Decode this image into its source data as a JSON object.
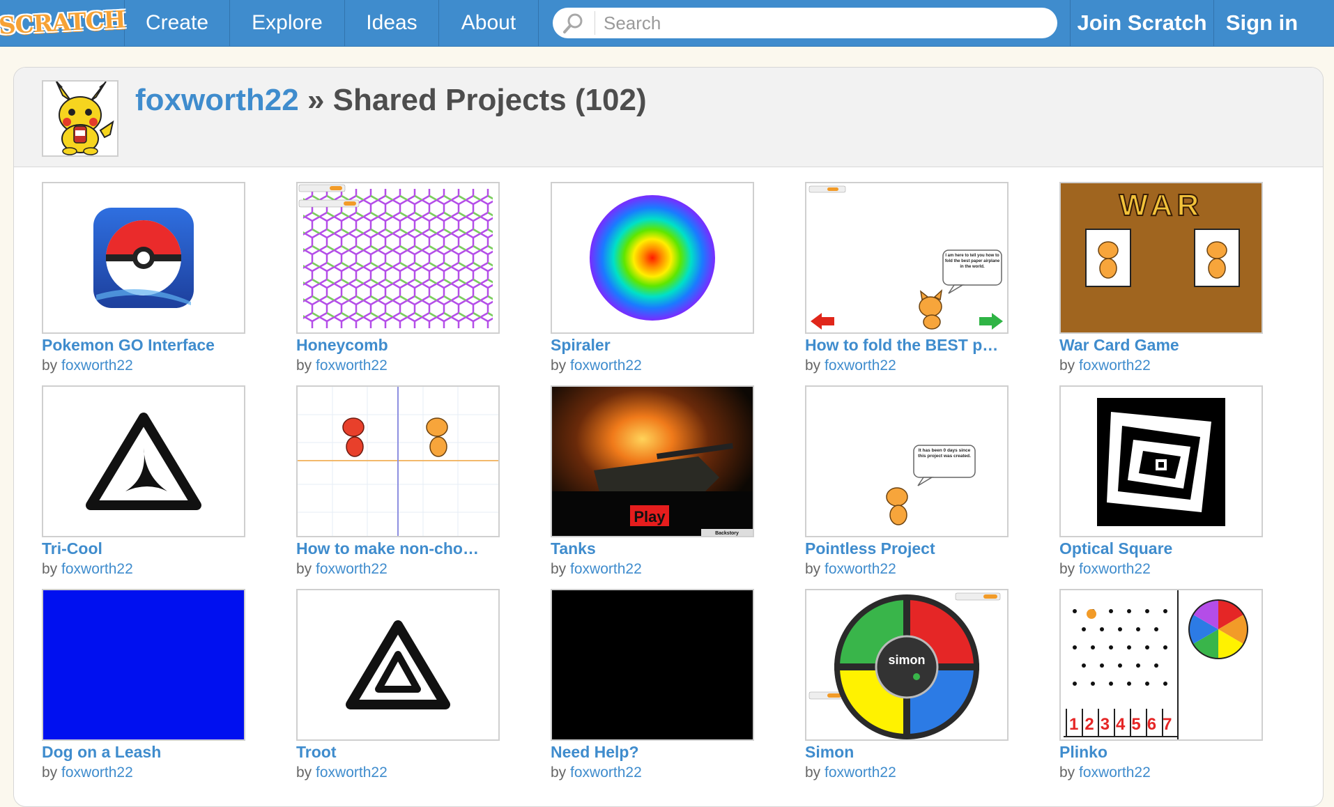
{
  "header": {
    "logo_text": "SCRATCH",
    "nav": [
      {
        "label": "Create"
      },
      {
        "label": "Explore"
      },
      {
        "label": "Ideas"
      },
      {
        "label": "About"
      }
    ],
    "search_placeholder": "Search",
    "join_label": "Join Scratch",
    "signin_label": "Sign in"
  },
  "page": {
    "username": "foxworth22",
    "separator": "»",
    "section_title": "Shared Projects (102)"
  },
  "by_label": "by",
  "projects": [
    {
      "title": "Pokemon GO Interface",
      "owner": "foxworth22"
    },
    {
      "title": "Honeycomb",
      "owner": "foxworth22"
    },
    {
      "title": "Spiraler",
      "owner": "foxworth22"
    },
    {
      "title": "How to fold the BEST p…",
      "owner": "foxworth22"
    },
    {
      "title": "War Card Game",
      "owner": "foxworth22"
    },
    {
      "title": "Tri-Cool",
      "owner": "foxworth22"
    },
    {
      "title": "How to make non-cho…",
      "owner": "foxworth22"
    },
    {
      "title": "Tanks",
      "owner": "foxworth22"
    },
    {
      "title": "Pointless Project",
      "owner": "foxworth22"
    },
    {
      "title": "Optical Square",
      "owner": "foxworth22"
    },
    {
      "title": "Dog on a Leash",
      "owner": "foxworth22"
    },
    {
      "title": "Troot",
      "owner": "foxworth22"
    },
    {
      "title": "Need Help?",
      "owner": "foxworth22"
    },
    {
      "title": "Simon",
      "owner": "foxworth22"
    },
    {
      "title": "Plinko",
      "owner": "foxworth22"
    }
  ],
  "thumb_text": {
    "war_title": "WAR",
    "tanks_play": "Play",
    "tanks_backstory": "Backstory",
    "simon_label": "simon",
    "plinko_numbers": "1234567",
    "paper_next": "Next",
    "paper_back": "Back",
    "paper_speech": "I am here to tell you how to fold the best paper airplane in the world.",
    "pointless_speech": "It has been 0 days since this project was created."
  },
  "colors": {
    "brand_blue": "#3f8ccd",
    "page_bg": "#fbf8ee"
  }
}
